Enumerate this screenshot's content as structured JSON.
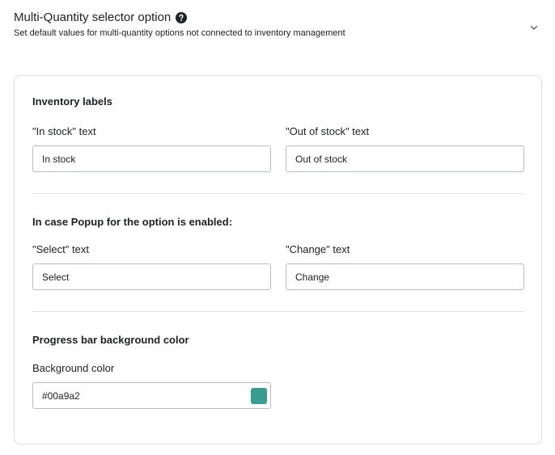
{
  "header": {
    "title": "Multi-Quantity selector option",
    "subtitle": "Set default values for multi-quantity options not connected to inventory management",
    "help_icon": "question-circle-icon",
    "expand_icon": "chevron-down-icon"
  },
  "inventory": {
    "title": "Inventory labels",
    "in_stock": {
      "label": "\"In stock\" text",
      "value": "In stock"
    },
    "out_of_stock": {
      "label": "\"Out of stock\" text",
      "value": "Out of stock"
    }
  },
  "popup": {
    "title": "In case Popup for the option is enabled:",
    "select": {
      "label": "\"Select\" text",
      "value": "Select"
    },
    "change": {
      "label": "\"Change\" text",
      "value": "Change"
    }
  },
  "progress": {
    "title": "Progress bar background color",
    "background": {
      "label": "Background color",
      "value": "#00a9a2",
      "swatch_color": "#3a9b8f"
    }
  }
}
